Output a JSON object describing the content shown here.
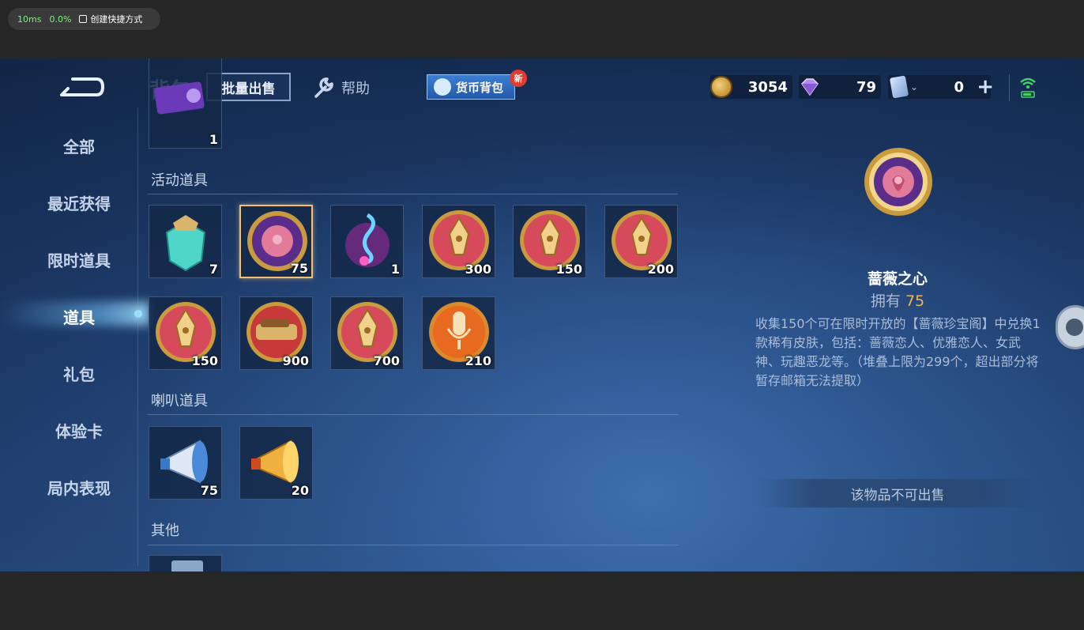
{
  "overlay": {
    "latency": "10ms",
    "percent": "0.0%",
    "shortcut_label": "创建快捷方式"
  },
  "header": {
    "title": "背包",
    "bulk_sell_label": "批量出售",
    "help_label": "帮助",
    "currency_bag_label": "货币背包",
    "new_badge": "新"
  },
  "resources": {
    "gold": "3054",
    "diamond": "79",
    "card": "0"
  },
  "nav": {
    "items": [
      "全部",
      "最近获得",
      "限时道具",
      "道具",
      "礼包",
      "体验卡",
      "局内表现"
    ],
    "active": "道具"
  },
  "sections": {
    "top_partial_count": "1",
    "activity_title": "活动道具",
    "speaker_title": "喇叭道具",
    "other_title": "其他"
  },
  "activity_items": [
    {
      "icon": "crystal-crown-icon",
      "count": "7"
    },
    {
      "icon": "rose-heart-coin-icon",
      "count": "75"
    },
    {
      "icon": "music-note-icon",
      "count": "1"
    },
    {
      "icon": "pen-coin-icon",
      "count": "300"
    },
    {
      "icon": "pen-coin-icon",
      "count": "150"
    },
    {
      "icon": "pen-coin-icon",
      "count": "200"
    },
    {
      "icon": "pen-coin-icon",
      "count": "150"
    },
    {
      "icon": "car-coin-icon",
      "count": "900"
    },
    {
      "icon": "pen-coin-icon",
      "count": "700"
    },
    {
      "icon": "microphone-coin-icon",
      "count": "210"
    }
  ],
  "speaker_items": [
    {
      "icon": "blue-megaphone-icon",
      "count": "75"
    },
    {
      "icon": "gold-megaphone-icon",
      "count": "20"
    }
  ],
  "detail": {
    "icon": "rose-heart-coin-icon",
    "name": "蔷薇之心",
    "own_label": "拥有",
    "own_count": "75",
    "description": "收集150个可在限时开放的【蔷薇珍宝阁】中兑换1款稀有皮肤，包括：蔷薇恋人、优雅恋人、女武神、玩趣恶龙等。（堆叠上限为299个，超出部分将暂存邮箱无法提取）",
    "sell_status": "该物品不可出售"
  },
  "colors": {
    "accent_gold": "#f0b45c",
    "badge_red": "#e03c30",
    "bag_blue": "#2f6cc0"
  }
}
